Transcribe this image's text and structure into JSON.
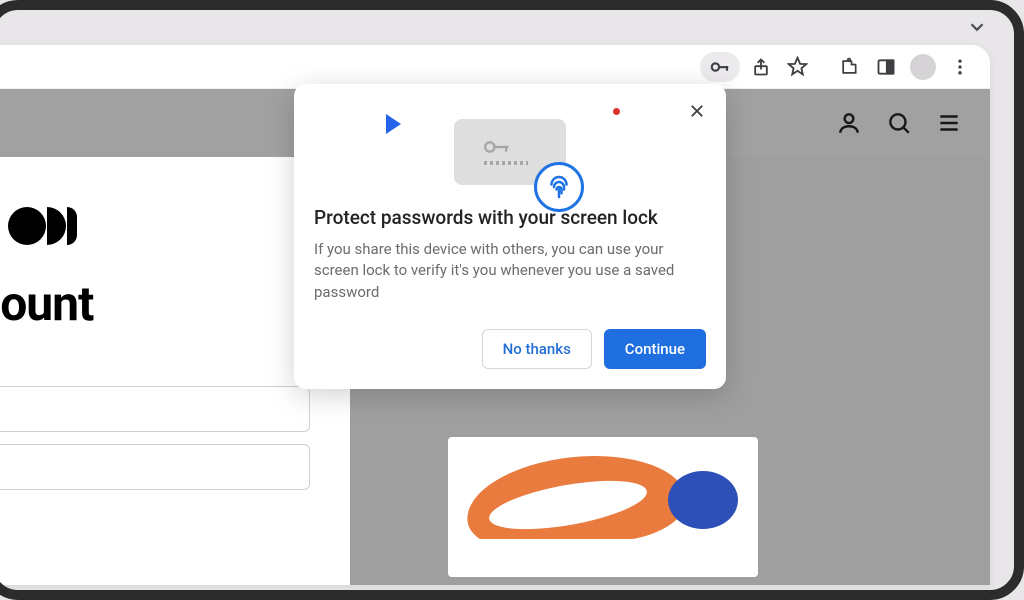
{
  "browser_toolbar": {
    "icons": [
      "password-manager-key-icon",
      "share-icon",
      "star-icon",
      "extensions-icon",
      "side-panel-icon",
      "profile-avatar-icon",
      "more-menu-icon"
    ]
  },
  "site": {
    "heading": "our account"
  },
  "popover": {
    "title": "Protect passwords with your screen lock",
    "body": "If you share this device with others, you can use your screen lock to verify it's you whenever you use a saved password",
    "secondary_label": "No thanks",
    "primary_label": "Continue"
  }
}
